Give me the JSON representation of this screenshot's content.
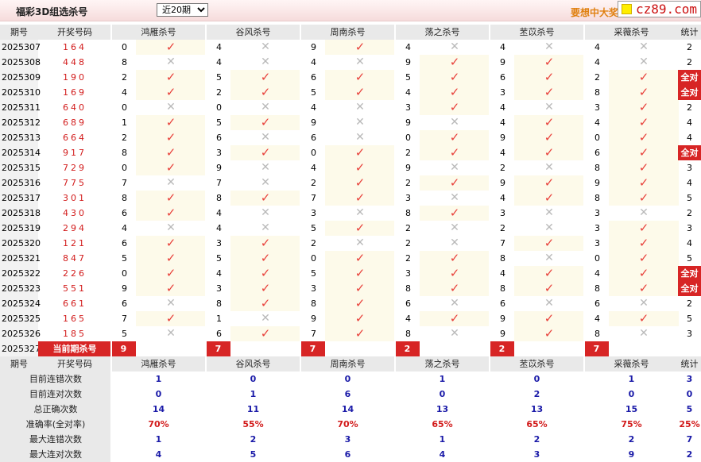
{
  "top": {
    "title": "福彩3D组选杀号",
    "period_selected": "近20期",
    "promo": "要想中大奖",
    "logo": "cz89.com"
  },
  "columns": {
    "issue": "期号",
    "draw": "开奖号码",
    "experts": [
      "鸿雁杀号",
      "谷风杀号",
      "周南杀号",
      "荡之杀号",
      "苤苡杀号",
      "采薇杀号"
    ],
    "stat": "统计"
  },
  "rows": [
    {
      "issue": "2025307",
      "draw": "164",
      "kills": [
        "0",
        "4",
        "9",
        "4",
        "4",
        "4"
      ],
      "res": [
        1,
        0,
        1,
        0,
        0,
        0
      ],
      "stat": "2"
    },
    {
      "issue": "2025308",
      "draw": "448",
      "kills": [
        "8",
        "4",
        "4",
        "9",
        "9",
        "4"
      ],
      "res": [
        0,
        0,
        0,
        1,
        1,
        0
      ],
      "stat": "2"
    },
    {
      "issue": "2025309",
      "draw": "190",
      "kills": [
        "2",
        "5",
        "6",
        "5",
        "6",
        "2"
      ],
      "res": [
        1,
        1,
        1,
        1,
        1,
        1
      ],
      "stat": "全对"
    },
    {
      "issue": "2025310",
      "draw": "169",
      "kills": [
        "4",
        "2",
        "5",
        "4",
        "3",
        "8"
      ],
      "res": [
        1,
        1,
        1,
        1,
        1,
        1
      ],
      "stat": "全对"
    },
    {
      "issue": "2025311",
      "draw": "640",
      "kills": [
        "0",
        "0",
        "4",
        "3",
        "4",
        "3"
      ],
      "res": [
        0,
        0,
        0,
        1,
        0,
        1
      ],
      "stat": "2"
    },
    {
      "issue": "2025312",
      "draw": "689",
      "kills": [
        "1",
        "5",
        "9",
        "9",
        "4",
        "4"
      ],
      "res": [
        1,
        1,
        0,
        0,
        1,
        1
      ],
      "stat": "4"
    },
    {
      "issue": "2025313",
      "draw": "664",
      "kills": [
        "2",
        "6",
        "6",
        "0",
        "9",
        "0"
      ],
      "res": [
        1,
        0,
        0,
        1,
        1,
        1
      ],
      "stat": "4"
    },
    {
      "issue": "2025314",
      "draw": "917",
      "kills": [
        "8",
        "3",
        "0",
        "2",
        "4",
        "6"
      ],
      "res": [
        1,
        1,
        1,
        1,
        1,
        1
      ],
      "stat": "全对"
    },
    {
      "issue": "2025315",
      "draw": "729",
      "kills": [
        "0",
        "9",
        "4",
        "9",
        "2",
        "8"
      ],
      "res": [
        1,
        0,
        1,
        0,
        0,
        1
      ],
      "stat": "3"
    },
    {
      "issue": "2025316",
      "draw": "775",
      "kills": [
        "7",
        "7",
        "2",
        "2",
        "9",
        "9"
      ],
      "res": [
        0,
        0,
        1,
        1,
        1,
        1
      ],
      "stat": "4"
    },
    {
      "issue": "2025317",
      "draw": "301",
      "kills": [
        "8",
        "8",
        "7",
        "3",
        "4",
        "8"
      ],
      "res": [
        1,
        1,
        1,
        0,
        1,
        1
      ],
      "stat": "5"
    },
    {
      "issue": "2025318",
      "draw": "430",
      "kills": [
        "6",
        "4",
        "3",
        "8",
        "3",
        "3"
      ],
      "res": [
        1,
        0,
        0,
        1,
        0,
        0
      ],
      "stat": "2"
    },
    {
      "issue": "2025319",
      "draw": "294",
      "kills": [
        "4",
        "4",
        "5",
        "2",
        "2",
        "3"
      ],
      "res": [
        0,
        0,
        1,
        0,
        0,
        1
      ],
      "stat": "3"
    },
    {
      "issue": "2025320",
      "draw": "121",
      "kills": [
        "6",
        "3",
        "2",
        "2",
        "7",
        "3"
      ],
      "res": [
        1,
        1,
        0,
        0,
        1,
        1
      ],
      "stat": "4"
    },
    {
      "issue": "2025321",
      "draw": "847",
      "kills": [
        "5",
        "5",
        "0",
        "2",
        "8",
        "0"
      ],
      "res": [
        1,
        1,
        1,
        1,
        0,
        1
      ],
      "stat": "5"
    },
    {
      "issue": "2025322",
      "draw": "226",
      "kills": [
        "0",
        "4",
        "5",
        "3",
        "4",
        "4"
      ],
      "res": [
        1,
        1,
        1,
        1,
        1,
        1
      ],
      "stat": "全对"
    },
    {
      "issue": "2025323",
      "draw": "551",
      "kills": [
        "9",
        "3",
        "3",
        "8",
        "8",
        "8"
      ],
      "res": [
        1,
        1,
        1,
        1,
        1,
        1
      ],
      "stat": "全对"
    },
    {
      "issue": "2025324",
      "draw": "661",
      "kills": [
        "6",
        "8",
        "8",
        "6",
        "6",
        "6"
      ],
      "res": [
        0,
        1,
        1,
        0,
        0,
        0
      ],
      "stat": "2"
    },
    {
      "issue": "2025325",
      "draw": "165",
      "kills": [
        "7",
        "1",
        "9",
        "4",
        "9",
        "4"
      ],
      "res": [
        1,
        0,
        1,
        1,
        1,
        1
      ],
      "stat": "5"
    },
    {
      "issue": "2025326",
      "draw": "185",
      "kills": [
        "5",
        "6",
        "7",
        "8",
        "9",
        "8"
      ],
      "res": [
        0,
        1,
        1,
        0,
        1,
        0
      ],
      "stat": "3"
    }
  ],
  "current": {
    "issue": "2025327",
    "label": "当前期杀号",
    "kills": [
      "9",
      "7",
      "7",
      "2",
      "2",
      "7"
    ]
  },
  "summary_header": {
    "issue": "期号",
    "draw": "开奖号码"
  },
  "summary": [
    {
      "label": "目前连错次数",
      "values": [
        "1",
        "0",
        "0",
        "1",
        "0",
        "1"
      ],
      "stat": "3"
    },
    {
      "label": "目前连对次数",
      "values": [
        "0",
        "1",
        "6",
        "0",
        "2",
        "0"
      ],
      "stat": "0"
    },
    {
      "label": "总正确次数",
      "values": [
        "14",
        "11",
        "14",
        "13",
        "13",
        "15"
      ],
      "stat": "5"
    },
    {
      "label": "准确率(全对率)",
      "values": [
        "70%",
        "55%",
        "70%",
        "65%",
        "65%",
        "75%"
      ],
      "stat": "25%",
      "pct": true
    },
    {
      "label": "最大连错次数",
      "values": [
        "1",
        "2",
        "3",
        "1",
        "2",
        "2"
      ],
      "stat": "7"
    },
    {
      "label": "最大连对次数",
      "values": [
        "4",
        "5",
        "6",
        "4",
        "3",
        "9"
      ],
      "stat": "2"
    }
  ],
  "icons": {
    "hit": "check-icon",
    "miss": "cross-icon"
  },
  "colors": {
    "accent": "#d72525",
    "hit": "#e8403a",
    "miss": "#b9b9b9",
    "value": "#1a1aa8",
    "highlight": "#fdfaea"
  }
}
